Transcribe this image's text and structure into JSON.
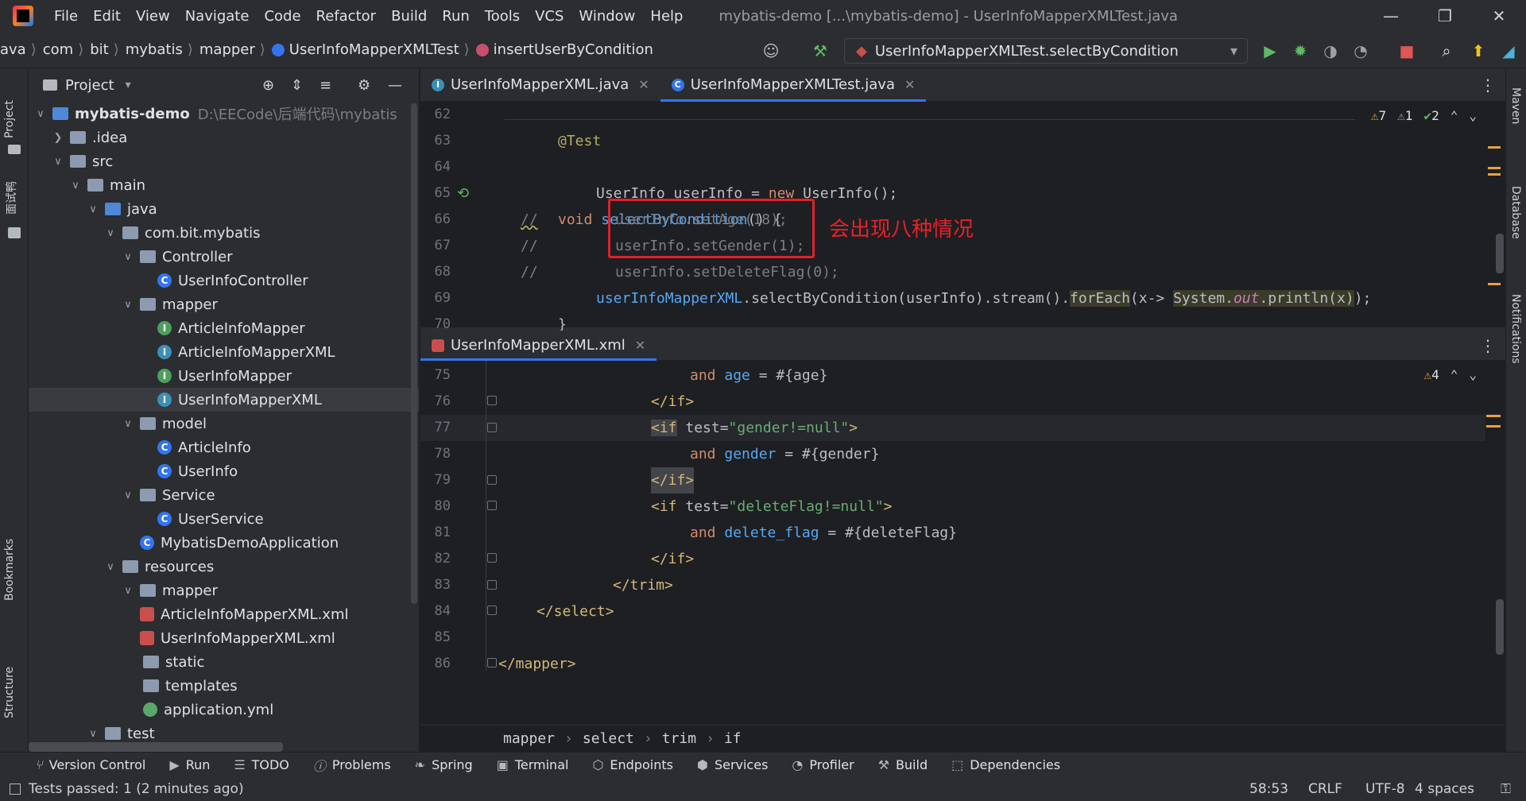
{
  "menu": {
    "items": [
      "File",
      "Edit",
      "View",
      "Navigate",
      "Code",
      "Refactor",
      "Build",
      "Run",
      "Tools",
      "VCS",
      "Window",
      "Help"
    ],
    "window_title": "mybatis-demo [...\\mybatis-demo] - UserInfoMapperXMLTest.java"
  },
  "navbar": {
    "crumbs": [
      "ava",
      "com",
      "bit",
      "mybatis",
      "mapper",
      "UserInfoMapperXMLTest",
      "insertUserByCondition"
    ],
    "run_config": "UserInfoMapperXMLTest.selectByCondition"
  },
  "side": {
    "left_top": "Project",
    "left_mid": "面试鸭",
    "left_bookmarks": "Bookmarks",
    "left_structure": "Structure",
    "right_maven": "Maven",
    "right_database": "Database",
    "right_notifications": "Notifications"
  },
  "project": {
    "title": "Project",
    "root": "mybatis-demo",
    "root_path": "D:\\EECode\\后端代码\\mybatis",
    "items": [
      {
        "label": ".idea"
      },
      {
        "label": "src"
      },
      {
        "label": "main"
      },
      {
        "label": "java"
      },
      {
        "label": "com.bit.mybatis"
      },
      {
        "label": "Controller"
      },
      {
        "label": "UserInfoController"
      },
      {
        "label": "mapper"
      },
      {
        "label": "ArticleInfoMapper"
      },
      {
        "label": "ArticleInfoMapperXML"
      },
      {
        "label": "UserInfoMapper"
      },
      {
        "label": "UserInfoMapperXML"
      },
      {
        "label": "model"
      },
      {
        "label": "ArticleInfo"
      },
      {
        "label": "UserInfo"
      },
      {
        "label": "Service"
      },
      {
        "label": "UserService"
      },
      {
        "label": "MybatisDemoApplication"
      },
      {
        "label": "resources"
      },
      {
        "label": "mapper"
      },
      {
        "label": "ArticleInfoMapperXML.xml"
      },
      {
        "label": "UserInfoMapperXML.xml"
      },
      {
        "label": "static"
      },
      {
        "label": "templates"
      },
      {
        "label": "application.yml"
      },
      {
        "label": "test"
      }
    ]
  },
  "tabs_top": [
    {
      "label": "UserInfoMapperXML.java"
    },
    {
      "label": "UserInfoMapperXMLTest.java"
    }
  ],
  "top_inspections": {
    "warn1": "7",
    "warn2": "1",
    "ok": "2"
  },
  "top_code": {
    "ln": [
      "62",
      "63",
      "64",
      "65",
      "66",
      "67",
      "68",
      "69",
      "70"
    ],
    "l63": "@Test",
    "l64_kw": "void",
    "l64_fn": "selectByCondition",
    "l64_rest": "() {",
    "l65": "UserInfo userInfo = ",
    "l65_kw": "new",
    "l65_rest": " UserInfo();",
    "l66_c": "//",
    "l66": "userInfo.setAge(18);",
    "l67_c": "//",
    "l67": "userInfo.setGender(1);",
    "l68_c": "//",
    "l68": "userInfo.setDeleteFlag(0);",
    "l69_a": "userInfoMapperXML",
    "l69_b": ".selectByCondition(userInfo).stream().",
    "l69_c": "forEach",
    "l69_d": "(x-> ",
    "l69_e": "System.",
    "l69_f": "out",
    "l69_g": ".println(x)",
    "l69_h": ");",
    "l70": "}",
    "note": "会出现八种情况"
  },
  "tab_bottom": {
    "label": "UserInfoMapperXML.xml"
  },
  "bottom_inspections": {
    "warn": "4"
  },
  "bottom_code": {
    "ln": [
      "75",
      "76",
      "77",
      "78",
      "79",
      "80",
      "81",
      "82",
      "83",
      "84",
      "85",
      "86"
    ],
    "l75_kw": "and",
    "l75_f": "age",
    "l75_r": " = #{age}",
    "l76": "</if>",
    "l77_t": "<if",
    "l77_a": " test=",
    "l77_s": "\"gender!=null\"",
    "l77_e": ">",
    "l78_kw": "and",
    "l78_f": "gender",
    "l78_r": " = #{gender}",
    "l79": "</if>",
    "l80_t": "<if",
    "l80_a": " test=",
    "l80_s": "\"deleteFlag!=null\"",
    "l80_e": ">",
    "l81_kw": "and",
    "l81_f": "delete_flag",
    "l81_r": " = #{deleteFlag}",
    "l82": "</if>",
    "l83": "</trim>",
    "l84": "</select>",
    "l86": "</mapper>"
  },
  "breadcrumb": [
    "mapper",
    "select",
    "trim",
    "if"
  ],
  "bottombar": [
    "Version Control",
    "Run",
    "TODO",
    "Problems",
    "Spring",
    "Terminal",
    "Endpoints",
    "Services",
    "Profiler",
    "Build",
    "Dependencies"
  ],
  "status": {
    "message": "Tests passed: 1 (2 minutes ago)",
    "position": "58:53",
    "line_sep": "CRLF",
    "encoding": "UTF-8",
    "indent": "4 spaces"
  }
}
